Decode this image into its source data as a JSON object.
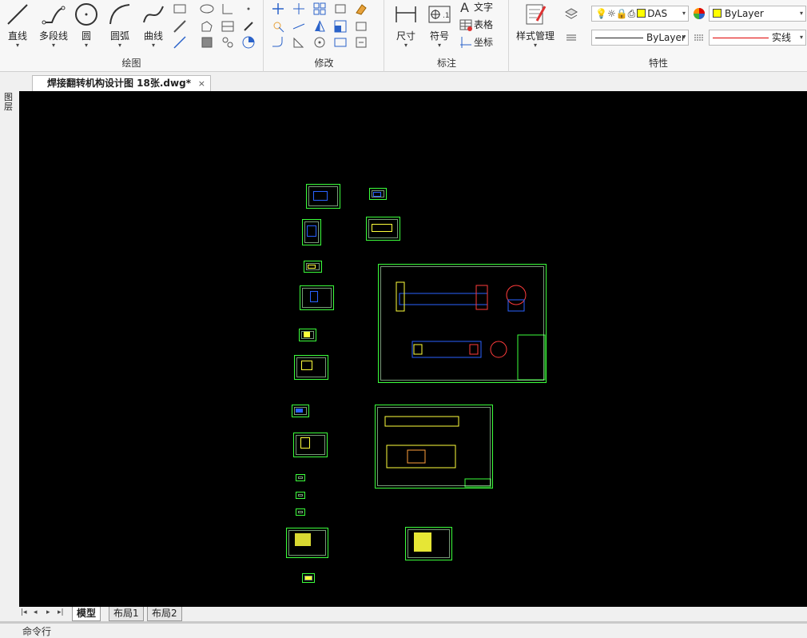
{
  "ribbon": {
    "draw_panel": {
      "title": "绘图",
      "tools": {
        "line": "直线",
        "polyline": "多段线",
        "circle": "圆",
        "arc": "圆弧",
        "curve": "曲线"
      }
    },
    "modify_panel": {
      "title": "修改"
    },
    "annotate_panel": {
      "title": "标注",
      "dimension": "尺寸",
      "symbol": "符号",
      "text": "文字",
      "table": "表格",
      "coordinate": "坐标"
    },
    "properties_panel": {
      "title": "特性",
      "style_manager": "样式管理",
      "layer_name": "DAS",
      "color_value": "ByLayer",
      "lineweight_value": "ByLayer",
      "linetype_value": "实线"
    }
  },
  "document": {
    "tab_title": "焊接翻转机构设计图 18张.dwg*",
    "close_glyph": "×"
  },
  "left_toolbar": {
    "label": "图层"
  },
  "layout_tabs": [
    "模型",
    "布局1",
    "布局2"
  ],
  "command_line": {
    "prompt": "命令行"
  },
  "colors": {
    "canvas_bg": "#000000",
    "sheet_border": "#3bff3b",
    "linetype_red": "#e00000",
    "bylayer_swatch": "#ffff00"
  }
}
